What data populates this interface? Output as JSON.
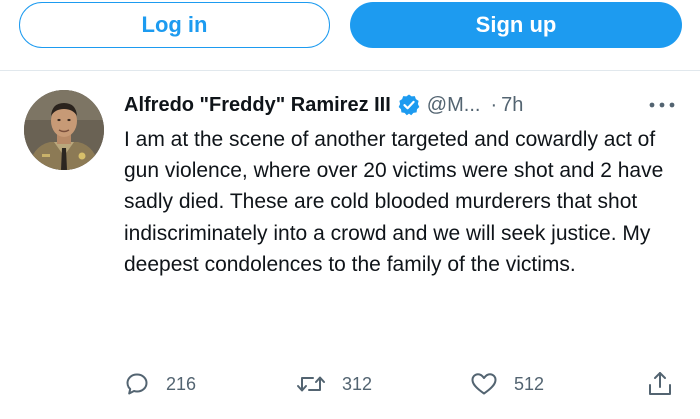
{
  "auth": {
    "login_label": "Log in",
    "signup_label": "Sign up"
  },
  "tweet": {
    "author_name": "Alfredo \"Freddy\" Ramirez III",
    "handle": "@M...",
    "separator": "·",
    "time": "7h",
    "verified": true,
    "text": "I am at the scene of another targeted and cowardly act of gun violence, where over 20 victims were shot and 2 have sadly died. These are cold blooded murderers that shot indiscriminately into a crowd and we will seek justice. My deepest condolences to the family of the victims.",
    "actions": {
      "replies": "216",
      "retweets": "312",
      "likes": "512"
    }
  },
  "icons": {
    "verified": "verified-badge-icon",
    "more": "more-options-icon",
    "reply": "reply-icon",
    "retweet": "retweet-icon",
    "like": "heart-icon",
    "share": "share-icon"
  },
  "colors": {
    "accent": "#1d9bf0",
    "text": "#0f1419",
    "muted": "#536471",
    "divider": "#e1e8ed"
  }
}
